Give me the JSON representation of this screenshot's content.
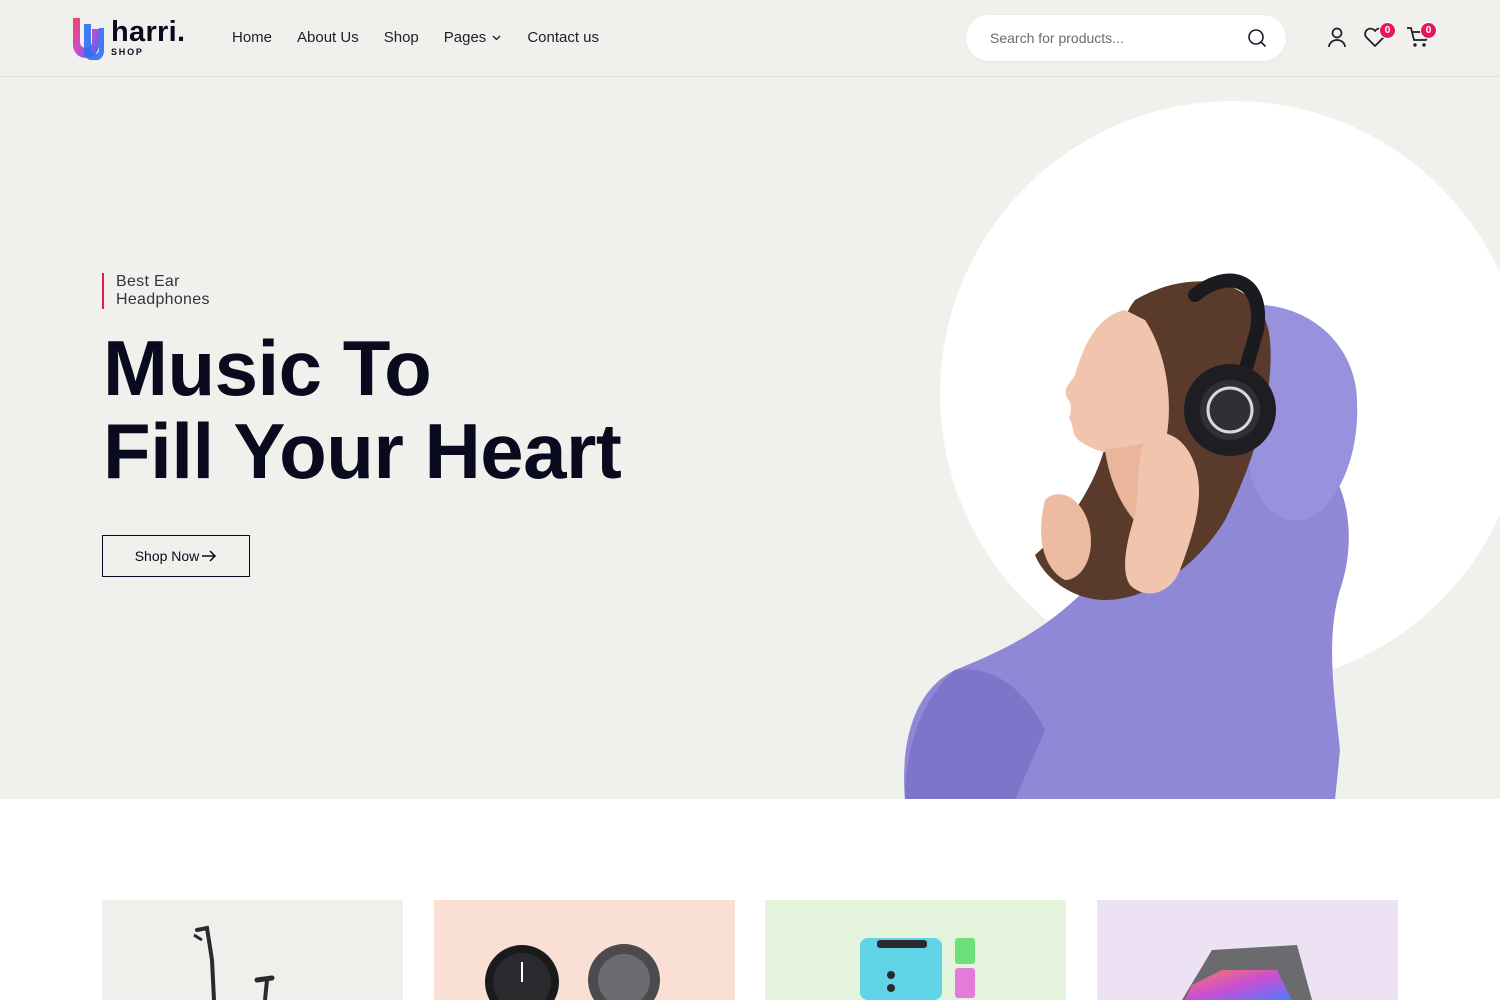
{
  "brand": {
    "name": "harri.",
    "tagline": "SHOP",
    "colors": {
      "accent": "#e6175f",
      "logo_pink": "#f0446c",
      "logo_blue": "#2b6ff5",
      "dark": "#0a0a1f",
      "hero_bg": "#f0f0ec"
    }
  },
  "nav": {
    "items": [
      {
        "label": "Home"
      },
      {
        "label": "About Us"
      },
      {
        "label": "Shop"
      },
      {
        "label": "Pages",
        "has_dropdown": true
      },
      {
        "label": "Contact us"
      }
    ]
  },
  "search": {
    "placeholder": "Search for products...",
    "icon": "search-icon"
  },
  "header_actions": {
    "account_icon": "user-icon",
    "wishlist": {
      "icon": "heart-icon",
      "count": "0"
    },
    "cart": {
      "icon": "cart-icon",
      "count": "0"
    }
  },
  "hero": {
    "subtitle": "Best Ear Headphones",
    "title_line1": "Music To",
    "title_line2": "Fill Your Heart",
    "cta_label": "Shop Now",
    "cta_icon": "arrow-right-icon",
    "image": "woman-wearing-headphones"
  },
  "categories": [
    {
      "image": "exercise-bike",
      "bg": "#eef0ec"
    },
    {
      "image": "smartwatches",
      "bg": "#f9dfd4"
    },
    {
      "image": "speakers",
      "bg": "#e3f3dc"
    },
    {
      "image": "tablet",
      "bg": "#ede1f4"
    }
  ]
}
